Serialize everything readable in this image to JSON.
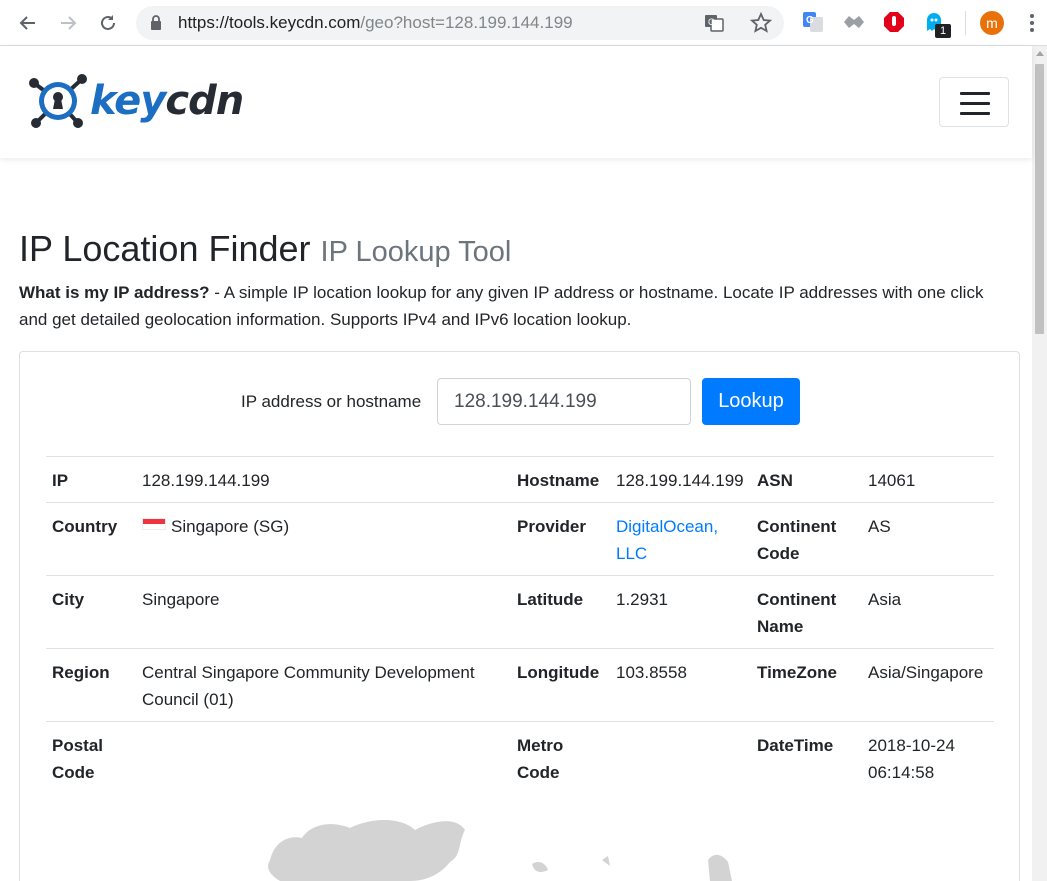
{
  "browser": {
    "url_host": "https://tools.keycdn.com",
    "url_path": "/geo?host=128.199.144.199",
    "profile_initial": "m",
    "extension_badge": "1"
  },
  "header": {
    "logo_key": "key",
    "logo_cdn": "cdn"
  },
  "page": {
    "title": "IP Location Finder",
    "subtitle": "IP Lookup Tool",
    "intro_bold": "What is my IP address?",
    "intro_text": " - A simple IP location lookup for any given IP address or hostname. Locate IP addresses with one click and get detailed geolocation information. Supports IPv4 and IPv6 location lookup."
  },
  "form": {
    "label": "IP address or hostname",
    "value": "128.199.144.199",
    "button": "Lookup"
  },
  "geo": {
    "ip_label": "IP",
    "ip": "128.199.144.199",
    "hostname_label": "Hostname",
    "hostname": "128.199.144.199",
    "asn_label": "ASN",
    "asn": "14061",
    "country_label": "Country",
    "country": "Singapore (SG)",
    "provider_label": "Provider",
    "provider": "DigitalOcean, LLC",
    "continent_code_label": "Continent Code",
    "continent_code": "AS",
    "city_label": "City",
    "city": "Singapore",
    "latitude_label": "Latitude",
    "latitude": "1.2931",
    "continent_name_label": "Continent Name",
    "continent_name": "Asia",
    "region_label": "Region",
    "region": "Central Singapore Community Development Council (01)",
    "longitude_label": "Longitude",
    "longitude": "103.8558",
    "timezone_label": "TimeZone",
    "timezone": "Asia/Singapore",
    "postal_label": "Postal Code",
    "postal": "",
    "metro_label": "Metro Code",
    "metro": "",
    "datetime_label": "DateTime",
    "datetime": "2018-10-24 06:14:58"
  }
}
